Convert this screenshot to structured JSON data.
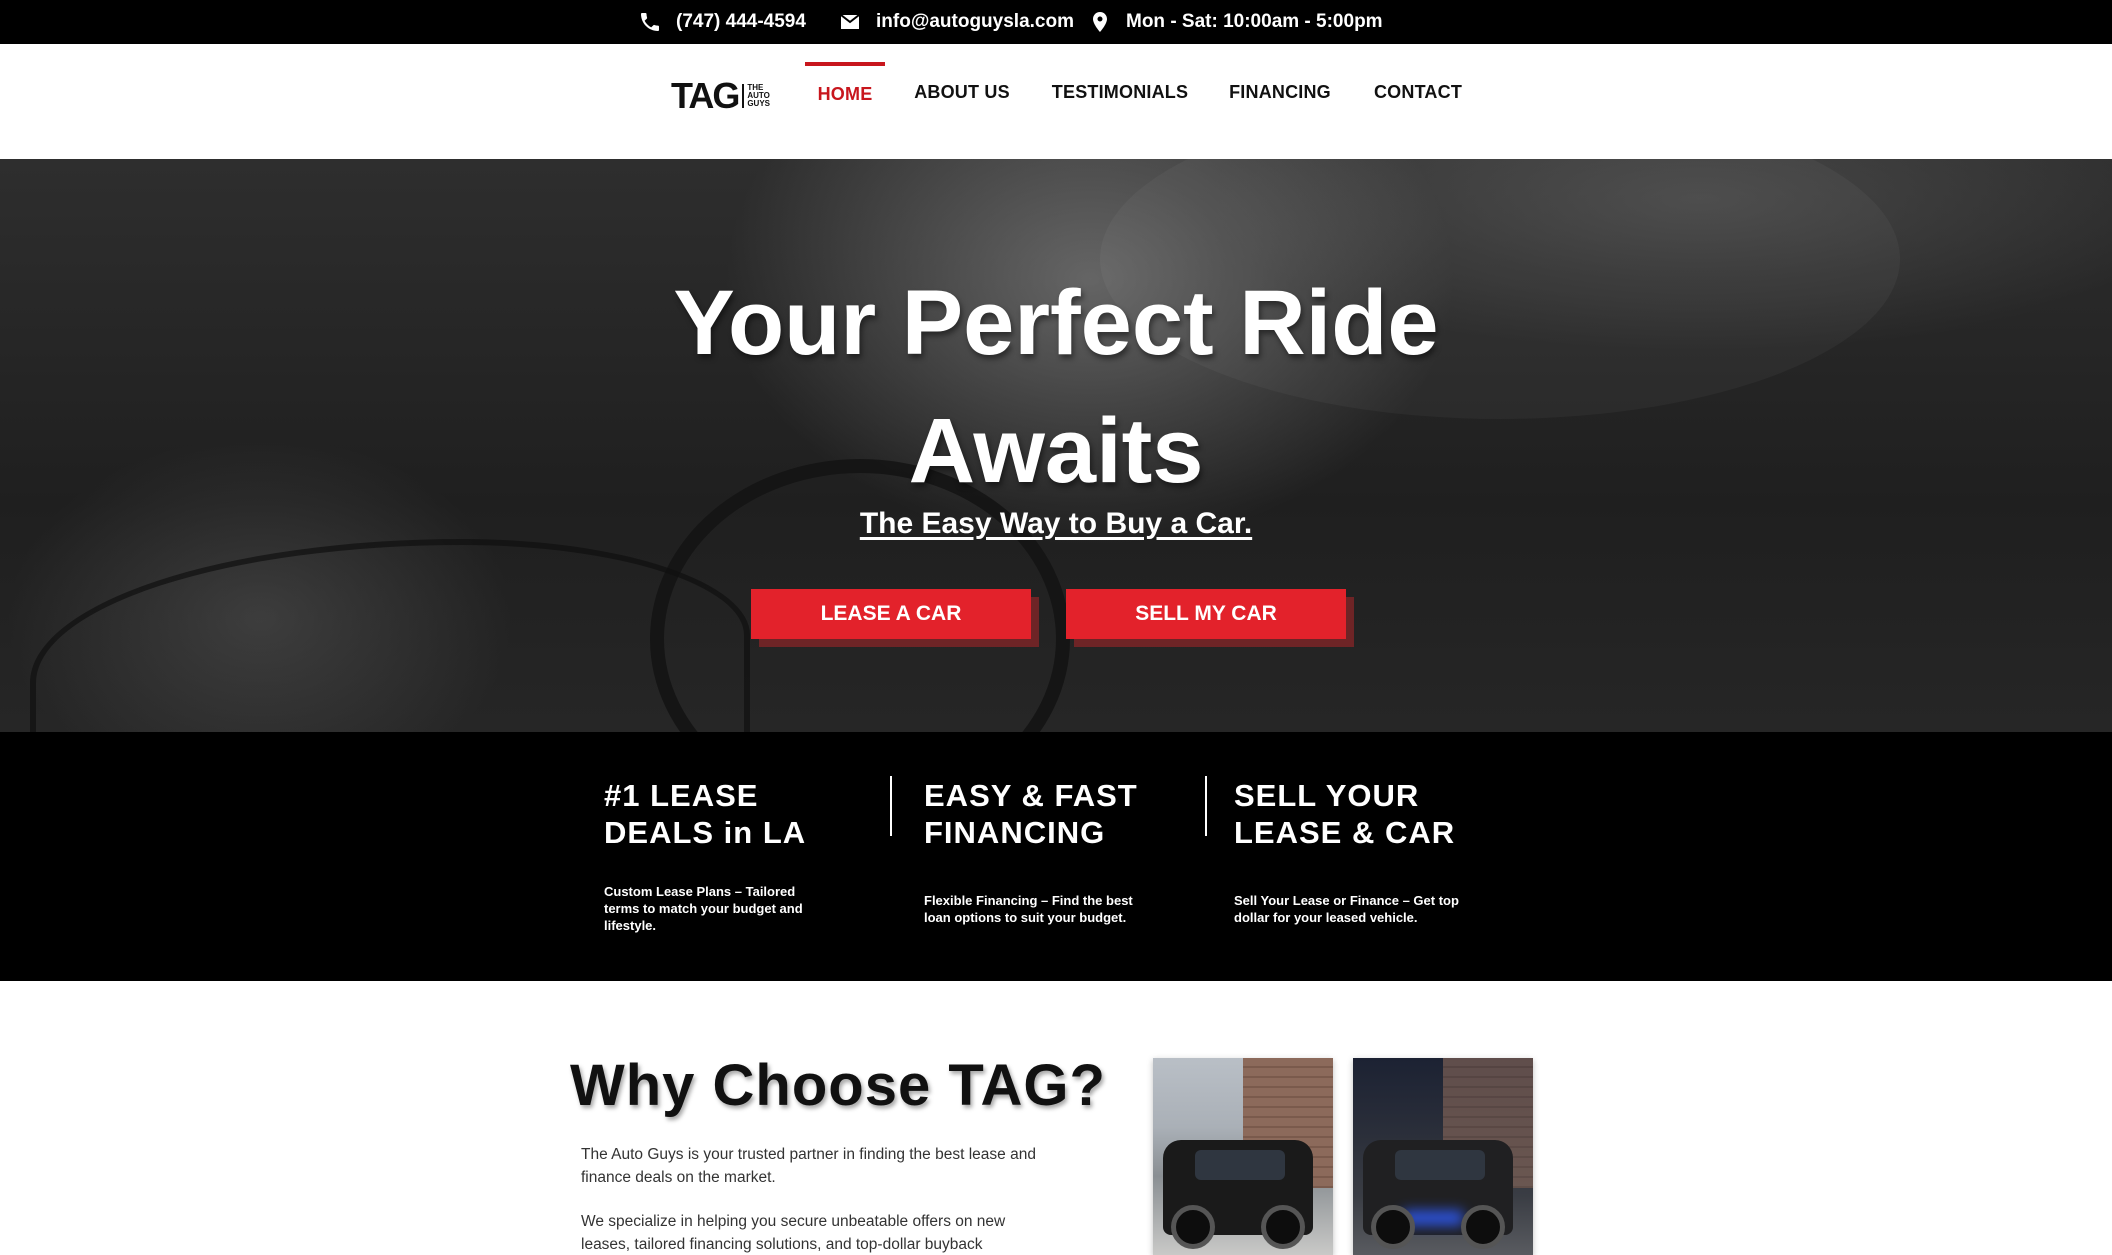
{
  "topbar": {
    "phone": "(747) 444-4594",
    "email": "info@autoguysla.com",
    "hours": "Mon - Sat: 10:00am - 5:00pm",
    "icons": [
      "phone-icon",
      "mail-icon",
      "location-pin-icon"
    ]
  },
  "logo": {
    "main": "TAG",
    "sub": [
      "THE",
      "AUTO",
      "GUYS"
    ]
  },
  "nav": {
    "items": [
      {
        "label": "HOME",
        "active": true
      },
      {
        "label": "ABOUT US"
      },
      {
        "label": "TESTIMONIALS"
      },
      {
        "label": "FINANCING"
      },
      {
        "label": "CONTACT"
      }
    ],
    "active_color": "#c8161d"
  },
  "hero": {
    "title_line1": "Your Perfect Ride",
    "title_line2": "Awaits",
    "subtitle": "The Easy Way to Buy a Car.",
    "buttons": [
      {
        "label": "LEASE A CAR"
      },
      {
        "label": "SELL MY CAR"
      }
    ],
    "button_color": "#e3222b"
  },
  "features": [
    {
      "title_line1": "#1 LEASE",
      "title_line2": "DEALS in LA",
      "text": "Custom Lease Plans – Tailored terms to match your budget and lifestyle."
    },
    {
      "title_line1": "EASY & FAST",
      "title_line2": "FINANCING",
      "text": "Flexible Financing – Find the best loan options to suit your budget."
    },
    {
      "title_line1": "SELL YOUR",
      "title_line2": "LEASE & CAR",
      "text": "Sell Your Lease or Finance – Get top dollar for your leased vehicle."
    }
  ],
  "why": {
    "title": "Why Choose TAG?",
    "p1": "The Auto Guys is your trusted partner in finding the best lease and finance deals on the market.",
    "p2": "We specialize in helping you secure unbeatable offers on new leases, tailored financing solutions, and top-dollar buyback"
  }
}
